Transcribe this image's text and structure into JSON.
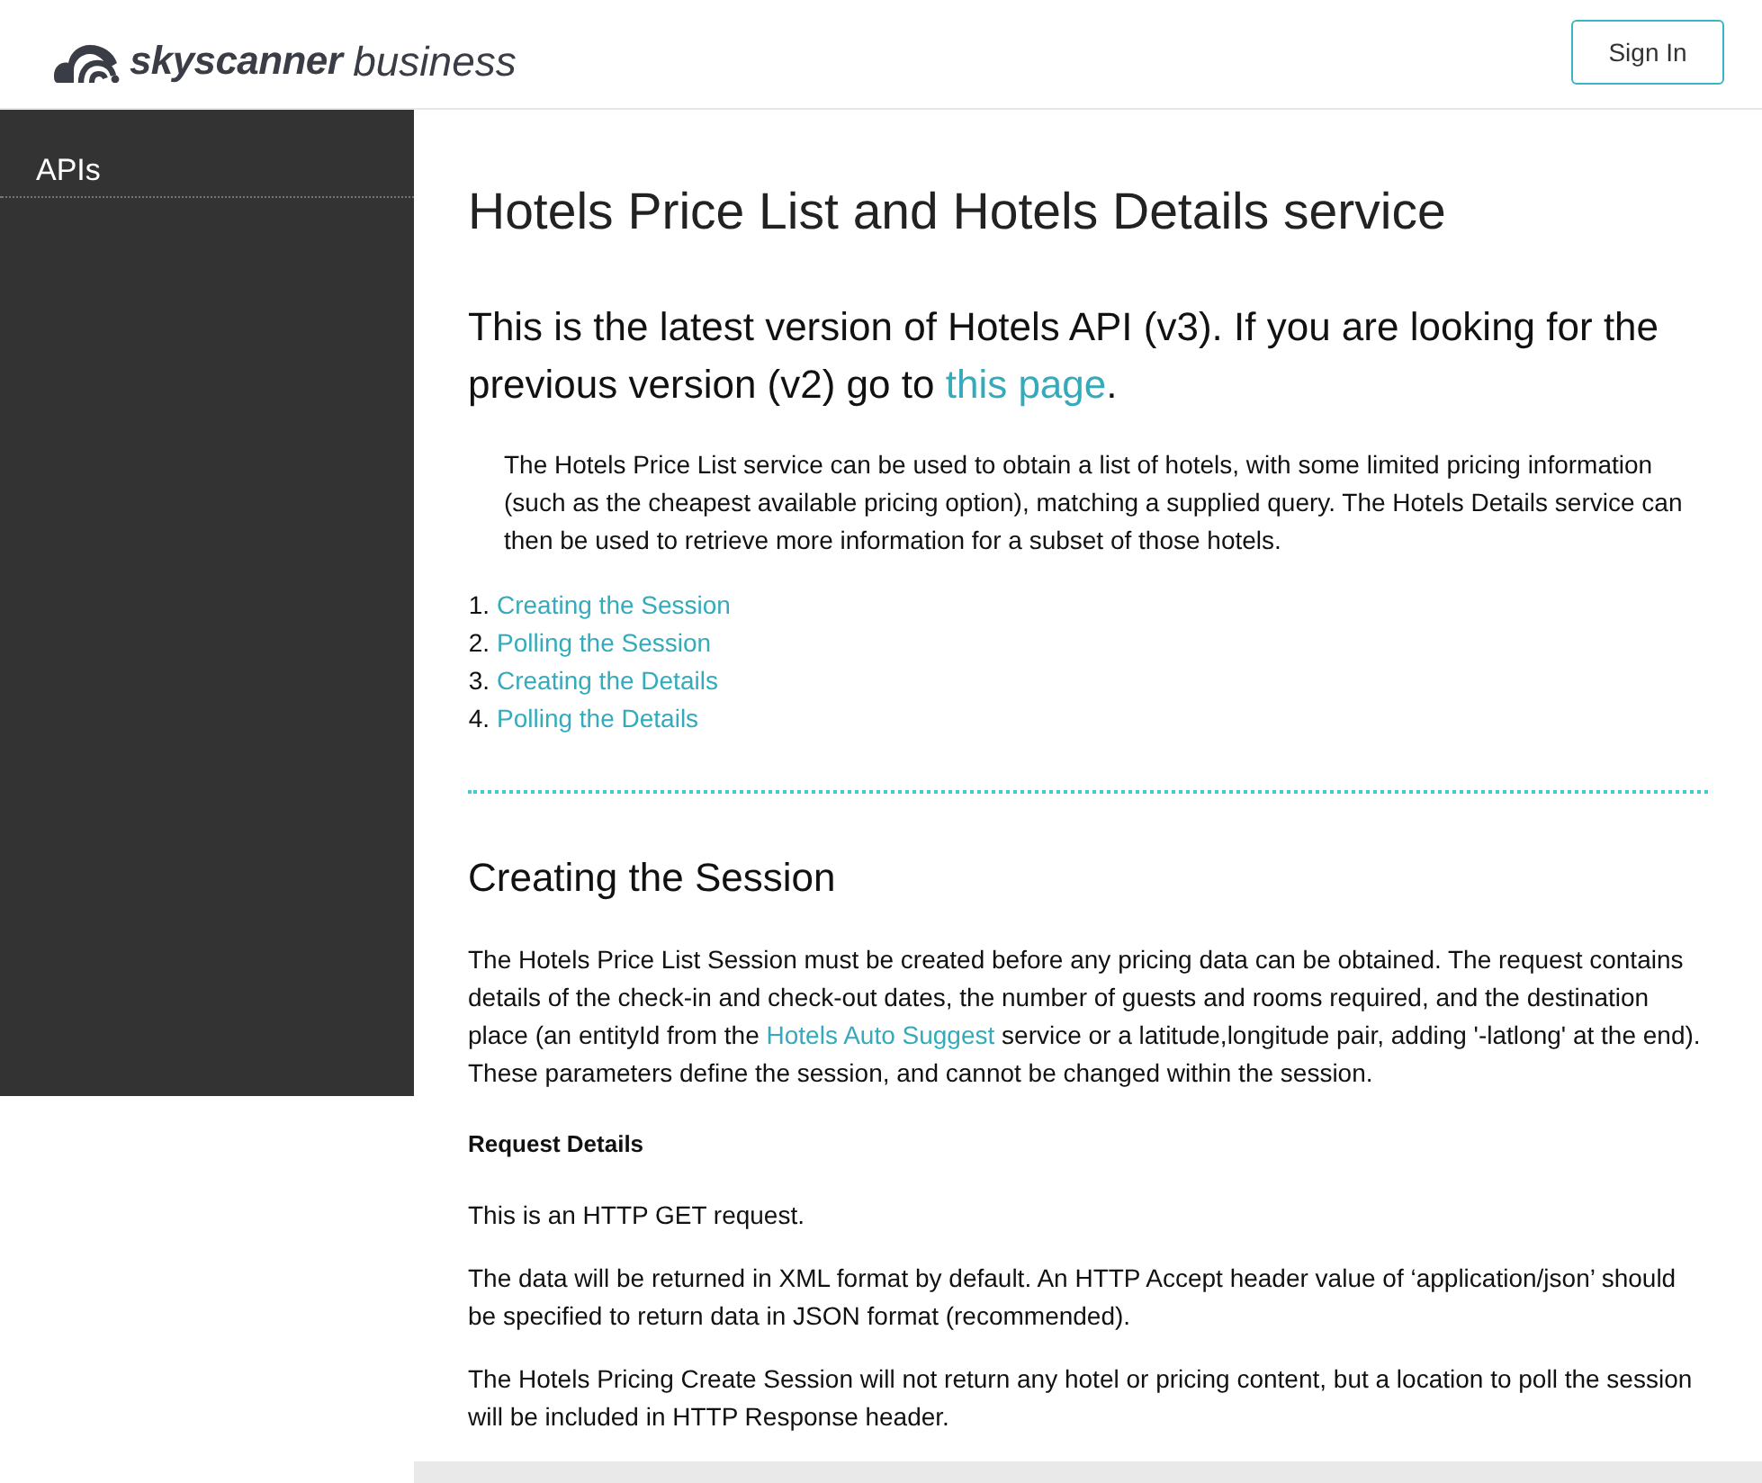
{
  "header": {
    "logo": {
      "brand": "skyscanner",
      "product": "business"
    },
    "sign_in": "Sign In"
  },
  "sidebar": {
    "items": [
      {
        "label": "APIs"
      }
    ]
  },
  "content": {
    "title": "Hotels Price List and Hotels Details service",
    "lead": [
      {
        "kind": "text",
        "text": "This is the latest version of Hotels API (v3). If you are looking for the previous version (v2) go to "
      },
      {
        "kind": "link",
        "text": "this page"
      },
      {
        "kind": "text",
        "text": "."
      }
    ],
    "intro": "The Hotels Price List service can be used to obtain a list of hotels, with some limited pricing information (such as the cheapest available pricing option), matching a supplied query. The Hotels Details service can then be used to retrieve more information for a subset of those hotels.",
    "toc": [
      {
        "number": "1.",
        "label": "Creating the Session"
      },
      {
        "number": "2.",
        "label": "Polling the Session"
      },
      {
        "number": "3.",
        "label": "Creating the Details"
      },
      {
        "number": "4.",
        "label": "Polling the Details"
      }
    ],
    "section": {
      "heading": "Creating the Session",
      "blocks": [
        {
          "kind": "paragraph",
          "parts": [
            {
              "kind": "text",
              "text": "The Hotels Price List Session must be created before any pricing data can be obtained. The request contains details of the check-in and check-out dates, the number of guests and rooms required, and the destination place (an entityId from the "
            },
            {
              "kind": "link",
              "text": "Hotels Auto Suggest"
            },
            {
              "kind": "text",
              "text": " service or a latitude,longitude pair, adding '-latlong' at the end). These parameters define the session, and cannot be changed within the session."
            }
          ]
        },
        {
          "kind": "subheading",
          "parts": [
            {
              "kind": "text",
              "text": "Request Details"
            }
          ]
        },
        {
          "kind": "paragraph",
          "parts": [
            {
              "kind": "text",
              "text": "This is an HTTP GET request."
            }
          ]
        },
        {
          "kind": "paragraph",
          "parts": [
            {
              "kind": "text",
              "text": "The data will be returned in XML format by default. An HTTP Accept header value of ‘application/json’ should be specified to return data in JSON format (recommended)."
            }
          ]
        },
        {
          "kind": "paragraph",
          "parts": [
            {
              "kind": "text",
              "text": "The Hotels Pricing Create Session will not return any hotel or pricing content, but a location to poll the session will be included in HTTP Response header."
            }
          ]
        }
      ]
    }
  }
}
